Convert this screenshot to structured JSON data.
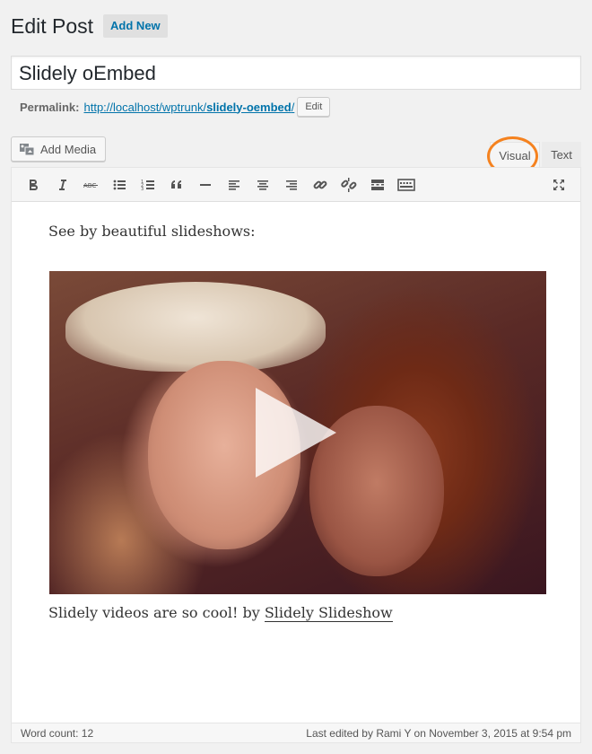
{
  "header": {
    "title": "Edit Post",
    "add_new_label": "Add New"
  },
  "post": {
    "title_value": "Slidely oEmbed",
    "permalink_label": "Permalink:",
    "permalink_base": "http://localhost/wptrunk/",
    "permalink_slug": "slidely-oembed",
    "permalink_trailing": "/",
    "permalink_edit_label": "Edit"
  },
  "media": {
    "add_media_label": "Add Media"
  },
  "tabs": {
    "visual_label": "Visual",
    "text_label": "Text",
    "active": "Visual"
  },
  "toolbar": {
    "buttons": [
      "bold-icon",
      "italic-icon",
      "strikethrough-icon",
      "bullet-list-icon",
      "numbered-list-icon",
      "blockquote-icon",
      "horizontal-rule-icon",
      "align-left-icon",
      "align-center-icon",
      "align-right-icon",
      "link-icon",
      "unlink-icon",
      "read-more-icon",
      "toolbar-toggle-icon"
    ],
    "fullscreen": "fullscreen-icon"
  },
  "content": {
    "intro": "See by beautiful slideshows:",
    "caption_prefix": "Slidely videos are so cool! by ",
    "caption_link": "Slidely Slideshow"
  },
  "status": {
    "word_count": "Word count: 12",
    "last_edited": "Last edited by Rami Y on November 3, 2015 at 9:54 pm"
  },
  "colors": {
    "accent_link": "#0073aa",
    "highlight_circle": "#f5821f"
  }
}
